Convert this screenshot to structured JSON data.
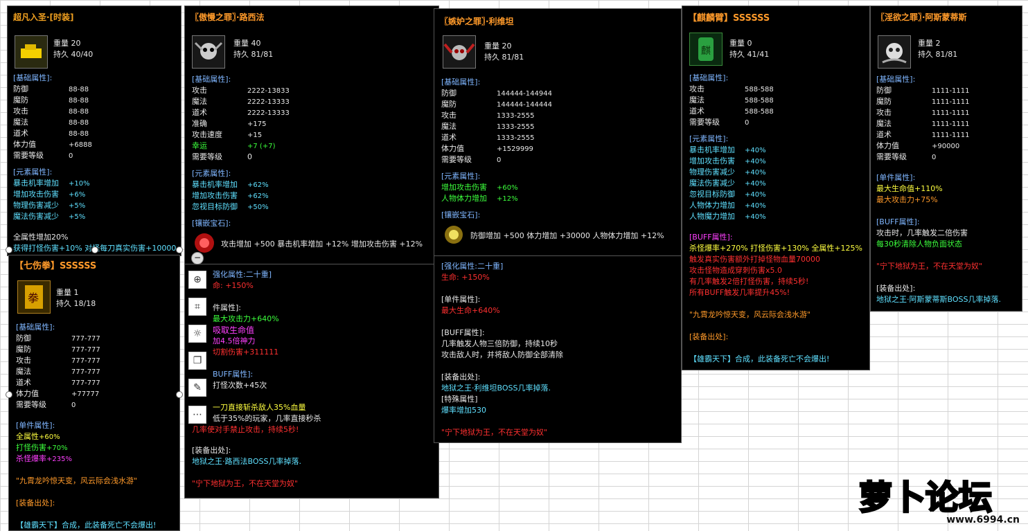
{
  "p1": {
    "title": "超凡入圣·[时装]",
    "weight": "重量 20",
    "dur": "持久 40/40",
    "base_label": "[基础属性]:",
    "base": [
      [
        "防御",
        "88-88"
      ],
      [
        "魔防",
        "88-88"
      ],
      [
        "攻击",
        "88-88"
      ],
      [
        "魔法",
        "88-88"
      ],
      [
        "道术",
        "88-88"
      ],
      [
        "体力值",
        "+6888"
      ],
      [
        "需要等级",
        "0"
      ]
    ],
    "elem_label": "[元素属性]:",
    "elem": [
      [
        "暴击机率增加",
        "+10%"
      ],
      [
        "增加攻击伤害",
        "+6%"
      ],
      [
        "物理伤害减少",
        "+5%"
      ],
      [
        "魔法伤害减少",
        "+5%"
      ]
    ],
    "extra1": "全属性增加20%",
    "extra2": "获得打怪伤害+10%  对怪每刀真实伤害+10000"
  },
  "p2": {
    "title": "【七伤拳】SSSSSS",
    "weight": "重量 1",
    "dur": "持久 18/18",
    "base_label": "[基础属性]:",
    "base": [
      [
        "防御",
        "777-777"
      ],
      [
        "魔防",
        "777-777"
      ],
      [
        "攻击",
        "777-777"
      ],
      [
        "魔法",
        "777-777"
      ],
      [
        "道术",
        "777-777"
      ],
      [
        "体力值",
        "+77777"
      ],
      [
        "需要等级",
        "0"
      ]
    ],
    "single_label": "[单件属性]:",
    "single": [
      [
        "全属性",
        "+60%"
      ],
      [
        "打怪伤害",
        "+70%"
      ],
      [
        "杀怪爆率",
        "+235%"
      ]
    ],
    "quote": "\"九霄龙吟惊天变，风云际会浅水游\"",
    "src_label": "[装备出处]:",
    "src": "【雄霸天下】合成，此装备死亡不会爆出!"
  },
  "p3": {
    "title": "〖傲慢之罪〗·路西法",
    "weight": "重量 40",
    "dur": "持久 81/81",
    "base_label": "[基础属性]:",
    "base": [
      [
        "攻击",
        "2222-13833"
      ],
      [
        "魔法",
        "2222-13333"
      ],
      [
        "道术",
        "2222-13333"
      ],
      [
        "准确",
        "+175"
      ],
      [
        "攻击速度",
        "+15"
      ]
    ],
    "luck": [
      "幸运",
      "+7 (+7)"
    ],
    "level": [
      "需要等级",
      "0"
    ],
    "elem_label": "[元素属性]:",
    "elem": [
      [
        "暴击机率增加",
        "+62%"
      ],
      [
        "增加攻击伤害",
        "+62%"
      ],
      [
        "忽视目标防御",
        "+50%"
      ]
    ],
    "gem_label": "[镶嵌宝石]:",
    "gem": "攻击增加 +500  暴击机率增加 +12%  增加攻击伤害 +12%",
    "enh_label": "强化属性:二十重]",
    "enh": "命: +150%",
    "single_label": "件属性]:",
    "single1": "最大攻击力+640%",
    "single2": "吸取生命值",
    "single3": "加4.5倍神力",
    "single4": "切割伤害+311111",
    "buff_label": "BUFF属性]:",
    "buff1": "打怪次数+45次",
    "buff2": "一刀直接斩杀敌人35%血量",
    "buff3": "低于35%的玩家，几率直接秒杀",
    "buff4": "几率使对手禁止攻击，持续5秒!",
    "src_label": "[装备出处]:",
    "src": "地狱之王·路西法BOSS几率掉落.",
    "quote": "\"宁下地狱为王，不在天堂为奴\""
  },
  "p4": {
    "title": "〖嫉妒之罪〗·利维坦",
    "weight": "重量 20",
    "dur": "持久 81/81",
    "base_label": "[基础属性]:",
    "base": [
      [
        "防御",
        "144444-144944"
      ],
      [
        "魔防",
        "144444-144444"
      ],
      [
        "攻击",
        "1333-2555"
      ],
      [
        "魔法",
        "1333-2555"
      ],
      [
        "道术",
        "1333-2555"
      ],
      [
        "体力值",
        "+1529999"
      ],
      [
        "需要等级",
        "0"
      ]
    ],
    "elem_label": "[元素属性]:",
    "elem": [
      [
        "增加攻击伤害",
        "+60%"
      ],
      [
        "人物体力增加",
        "+12%"
      ]
    ],
    "gem_label": "[镶嵌宝石]:",
    "gem": "防御增加 +500  体力增加 +30000  人物体力增加 +12%",
    "enh_label": "[强化属性:二十重]",
    "enh": "生命: +150%",
    "single_label": "[单件属性]:",
    "single": "最大生命+640%",
    "buff_label": "[BUFF属性]:",
    "buff1": "几率触发人物三倍防御，持续10秒",
    "buff2": "攻击敌人时，并将敌人防御全部清除",
    "src_label": "[装备出处]:",
    "src": "地狱之王·利维坦BOSS几率掉落.",
    "special_label": "[特殊属性]",
    "special": "爆率增加530",
    "quote": "\"宁下地狱为王，不在天堂为奴\""
  },
  "p5": {
    "title": "【麒麟臂】SSSSSS",
    "weight": "重量 0",
    "dur": "持久 41/41",
    "base_label": "[基础属性]:",
    "base": [
      [
        "攻击",
        "588-588"
      ],
      [
        "魔法",
        "588-588"
      ],
      [
        "道术",
        "588-588"
      ],
      [
        "需要等级",
        "0"
      ]
    ],
    "elem_label": "[元素属性]:",
    "elem": [
      [
        "暴击机率增加",
        "+40%"
      ],
      [
        "增加攻击伤害",
        "+40%"
      ],
      [
        "物理伤害减少",
        "+40%"
      ],
      [
        "魔法伤害减少",
        "+40%"
      ],
      [
        "忽视目标防御",
        "+40%"
      ],
      [
        "人物体力增加",
        "+40%"
      ],
      [
        "人物魔力增加",
        "+40%"
      ]
    ],
    "buff_label": "[BUFF属性]:",
    "buff1": "杀怪爆率+270%  打怪伤害+130%  全属性+125%",
    "buff2": "触发真实伤害额外打掉怪物血量70000",
    "buff3": "攻击怪物造成穿刺伤害x5.0",
    "buff4": "有几率触发2倍打怪伤害，持续5秒!",
    "buff5": "所有BUFF触发几率提升45%!",
    "quote": "\"九霄龙吟惊天变，风云际会浅水游\"",
    "src_label": "[装备出处]:",
    "src": "【雄霸天下】合成，此装备死亡不会爆出!"
  },
  "p6": {
    "title": "〖淫欲之罪〗·阿斯蒙蒂斯",
    "weight": "重量 2",
    "dur": "持久 81/81",
    "base_label": "[基础属性]:",
    "base": [
      [
        "防御",
        "1111-1111"
      ],
      [
        "魔防",
        "1111-1111"
      ],
      [
        "攻击",
        "1111-1111"
      ],
      [
        "魔法",
        "1111-1111"
      ],
      [
        "道术",
        "1111-1111"
      ],
      [
        "体力值",
        "+90000"
      ],
      [
        "需要等级",
        "0"
      ]
    ],
    "single_label": "[单件属性]:",
    "single1": "最大生命值+110%",
    "single2": "最大攻击力+75%",
    "buff_label": "[BUFF属性]:",
    "buff1": "攻击时，几率触发二倍伤害",
    "buff2": "每30秒清除人物负面状态",
    "quote": "\"宁下地狱为王，不在天堂为奴\"",
    "src_label": "[装备出处]:",
    "src": "地狱之王·阿斯蒙蒂斯BOSS几率掉落."
  },
  "logo": {
    "text": "萝卜论坛",
    "url": "www.6994.cn"
  },
  "toolbar": [
    "zoom-in-icon",
    "crop-icon",
    "bulb-icon",
    "copy-icon",
    "edit-icon",
    "more-icon"
  ]
}
